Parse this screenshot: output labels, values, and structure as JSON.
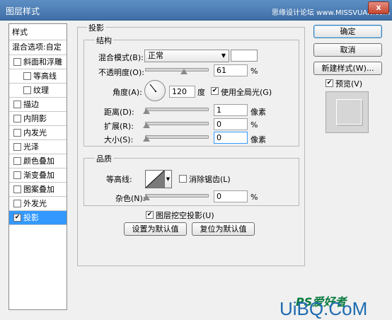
{
  "window": {
    "title": "图层样式",
    "watermark": "思缘设计论坛 www.MISSVUAN.com",
    "close_label": "x"
  },
  "sidebar": {
    "header": "样式",
    "blend_options": "混合选项:自定",
    "items": [
      {
        "label": "斜面和浮雕",
        "checked": false,
        "indent": false
      },
      {
        "label": "等高线",
        "checked": false,
        "indent": true
      },
      {
        "label": "纹理",
        "checked": false,
        "indent": true
      },
      {
        "label": "描边",
        "checked": false,
        "indent": false
      },
      {
        "label": "内阴影",
        "checked": false,
        "indent": false
      },
      {
        "label": "内发光",
        "checked": false,
        "indent": false
      },
      {
        "label": "光泽",
        "checked": false,
        "indent": false
      },
      {
        "label": "颜色叠加",
        "checked": false,
        "indent": false
      },
      {
        "label": "渐变叠加",
        "checked": false,
        "indent": false
      },
      {
        "label": "图案叠加",
        "checked": false,
        "indent": false
      },
      {
        "label": "外发光",
        "checked": false,
        "indent": false
      },
      {
        "label": "投影",
        "checked": true,
        "indent": false,
        "selected": true
      }
    ]
  },
  "drop_shadow": {
    "section_title": "投影",
    "structure_title": "结构",
    "blend_mode_label": "混合模式(B):",
    "blend_mode_value": "正常",
    "opacity_label": "不透明度(O):",
    "opacity_value": "61",
    "opacity_percent": 61,
    "percent": "%",
    "angle_label": "角度(A):",
    "angle_value": "120",
    "angle_unit": "度",
    "global_light_label": "使用全局光(G)",
    "global_light_checked": true,
    "distance_label": "距离(D):",
    "distance_value": "1",
    "distance_unit": "像素",
    "spread_label": "扩展(R):",
    "spread_value": "0",
    "size_label": "大小(S):",
    "size_value": "0",
    "size_unit": "像素",
    "quality_title": "品质",
    "contour_label": "等高线:",
    "anti_alias_label": "消除锯齿(L)",
    "anti_alias_checked": false,
    "noise_label": "杂色(N):",
    "noise_value": "0",
    "knockout_label": "图层挖空投影(U)",
    "knockout_checked": true,
    "make_default": "设置为默认值",
    "reset_default": "复位为默认值"
  },
  "buttons": {
    "ok": "确定",
    "cancel": "取消",
    "new_style": "新建样式(W)...",
    "preview_label": "预览(V)",
    "preview_checked": true
  },
  "branding": {
    "logo": "PS爱好者",
    "brand": "UiBQ.CoM"
  },
  "colors": {
    "title_bar": "#4a7db5",
    "selection": "#3399ff",
    "brand_blue": "#1d6bb0",
    "logo_green": "#0b7a3e"
  }
}
